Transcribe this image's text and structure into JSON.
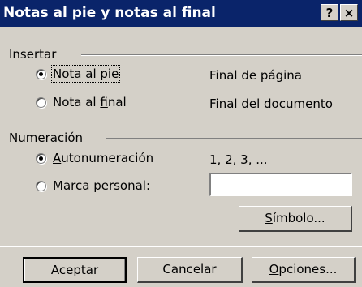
{
  "window": {
    "title": "Notas al pie y notas al final",
    "help_glyph": "?",
    "close_glyph": "×"
  },
  "insertar": {
    "group_label": "Insertar",
    "options": [
      {
        "label_pre": "",
        "label_acc": "N",
        "label_post": "ota al pie",
        "checked": true,
        "info": "Final de página"
      },
      {
        "label_pre": "Nota al ",
        "label_acc": "f",
        "label_post": "inal",
        "checked": false,
        "info": "Final del documento"
      }
    ]
  },
  "numeracion": {
    "group_label": "Numeración",
    "auto": {
      "label_pre": "",
      "label_acc": "A",
      "label_post": "utonumeración",
      "checked": true,
      "info": "1, 2, 3, ..."
    },
    "custom": {
      "label_pre": "",
      "label_acc": "M",
      "label_post": "arca personal:",
      "checked": false,
      "value": ""
    },
    "symbol_button": {
      "pre": "",
      "acc": "S",
      "post": "ímbolo..."
    }
  },
  "buttons": {
    "ok": "Aceptar",
    "cancel": "Cancelar",
    "options": {
      "pre": "",
      "acc": "O",
      "post": "pciones..."
    }
  }
}
